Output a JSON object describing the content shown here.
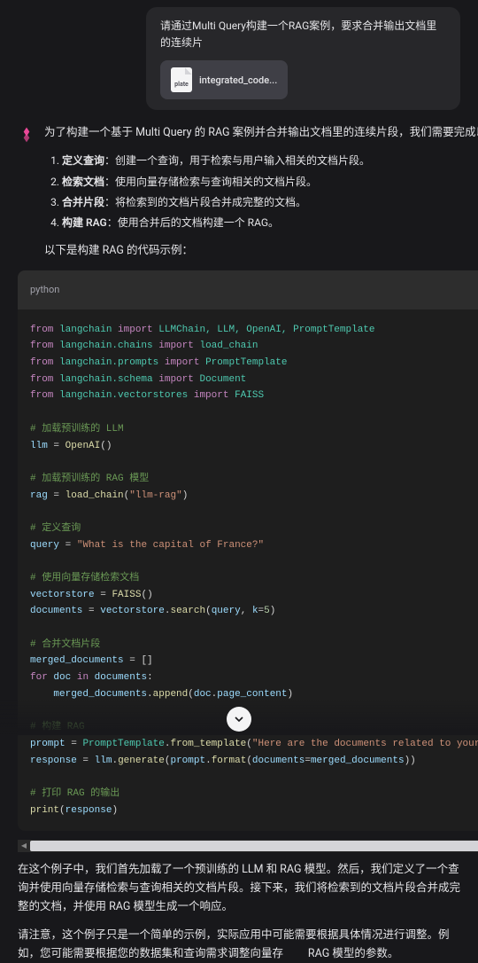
{
  "user_message": {
    "text": "请通过Multi Query构建一个RAG案例，要求合并输出文档里的连续片",
    "attachment": {
      "file_label": "plate",
      "name": "integrated_code..."
    }
  },
  "response": {
    "intro": "为了构建一个基于 Multi Query 的 RAG 案例并合并输出文档里的连续片段，我们需要完成以下步骤：",
    "steps": [
      {
        "title": "定义查询",
        "desc": "：创建一个查询，用于检索与用户输入相关的文档片段。"
      },
      {
        "title": "检索文档",
        "desc": "：使用向量存储检索与查询相关的文档片段。"
      },
      {
        "title": "合并片段",
        "desc": "：将检索到的文档片段合并成完整的文档。"
      },
      {
        "title": "构建 RAG",
        "desc": "：使用合并后的文档构建一个 RAG。"
      }
    ],
    "code_intro": "以下是构建 RAG 的代码示例：",
    "code_lang": "python",
    "paragraphs": [
      "在这个例子中，我们首先加载了一个预训练的 LLM 和 RAG 模型。然后，我们定义了一个查询并使用向量存储检索与查询相关的文档片段。接下来，我们将检索到的文档片段合并成完整的文档，并使用 RAG 模型生成一个响应。",
      "请注意，这个例子只是一个简单的示例，实际应用中可能需要根据具体情况进行调整。例如，您可能需要根据您的数据集和查询需求调整向量存"
    ],
    "trailing_fragment": "RAG 模型的参数。"
  },
  "code": {
    "c1": "# 加载预训练的 LLM",
    "c2": "# 加载预训练的 RAG 模型",
    "c3": "# 定义查询",
    "c4": "# 使用向量存储检索文档",
    "c5": "# 合并文档片段",
    "c6": "# 构建 RAG",
    "c7": "# 打印 RAG 的输出",
    "s1": "\"llm-rag\"",
    "s2": "\"What is the capital of France?\"",
    "s3": "\"Here are the documents related to your query: {documents}\"",
    "n1": "5"
  }
}
